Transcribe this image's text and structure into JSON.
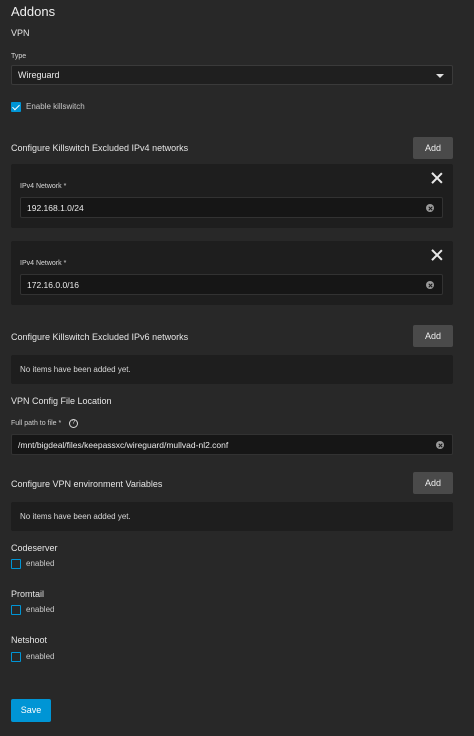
{
  "header": {
    "title": "Addons"
  },
  "vpn": {
    "section_label": "VPN",
    "type_label": "Type",
    "type_value": "Wireguard",
    "killswitch_label": "Enable killswitch",
    "killswitch_checked": true
  },
  "ipv4": {
    "section_label": "Configure Killswitch Excluded IPv4 networks",
    "add_label": "Add",
    "items": [
      {
        "label": "IPv4 Network *",
        "value": "192.168.1.0/24"
      },
      {
        "label": "IPv4 Network *",
        "value": "172.16.0.0/16"
      }
    ]
  },
  "ipv6": {
    "section_label": "Configure Killswitch Excluded IPv6 networks",
    "add_label": "Add",
    "empty_message": "No items have been added yet."
  },
  "config_file": {
    "section_label": "VPN Config File Location",
    "field_label": "Full path to file *",
    "help_glyph": "?",
    "value": "/mnt/bigdeal/files/keepassxc/wireguard/mullvad-nl2.conf"
  },
  "env_vars": {
    "section_label": "Configure VPN environment Variables",
    "add_label": "Add",
    "empty_message": "No items have been added yet."
  },
  "addons": [
    {
      "title": "Codeserver",
      "checkbox_label": "enabled",
      "checked": false
    },
    {
      "title": "Promtail",
      "checkbox_label": "enabled",
      "checked": false
    },
    {
      "title": "Netshoot",
      "checkbox_label": "enabled",
      "checked": false
    }
  ],
  "footer": {
    "save_label": "Save"
  },
  "colors": {
    "accent": "#0095d5",
    "background": "#282828",
    "card": "#1e1e1e",
    "button_secondary": "#4a4a4a"
  }
}
